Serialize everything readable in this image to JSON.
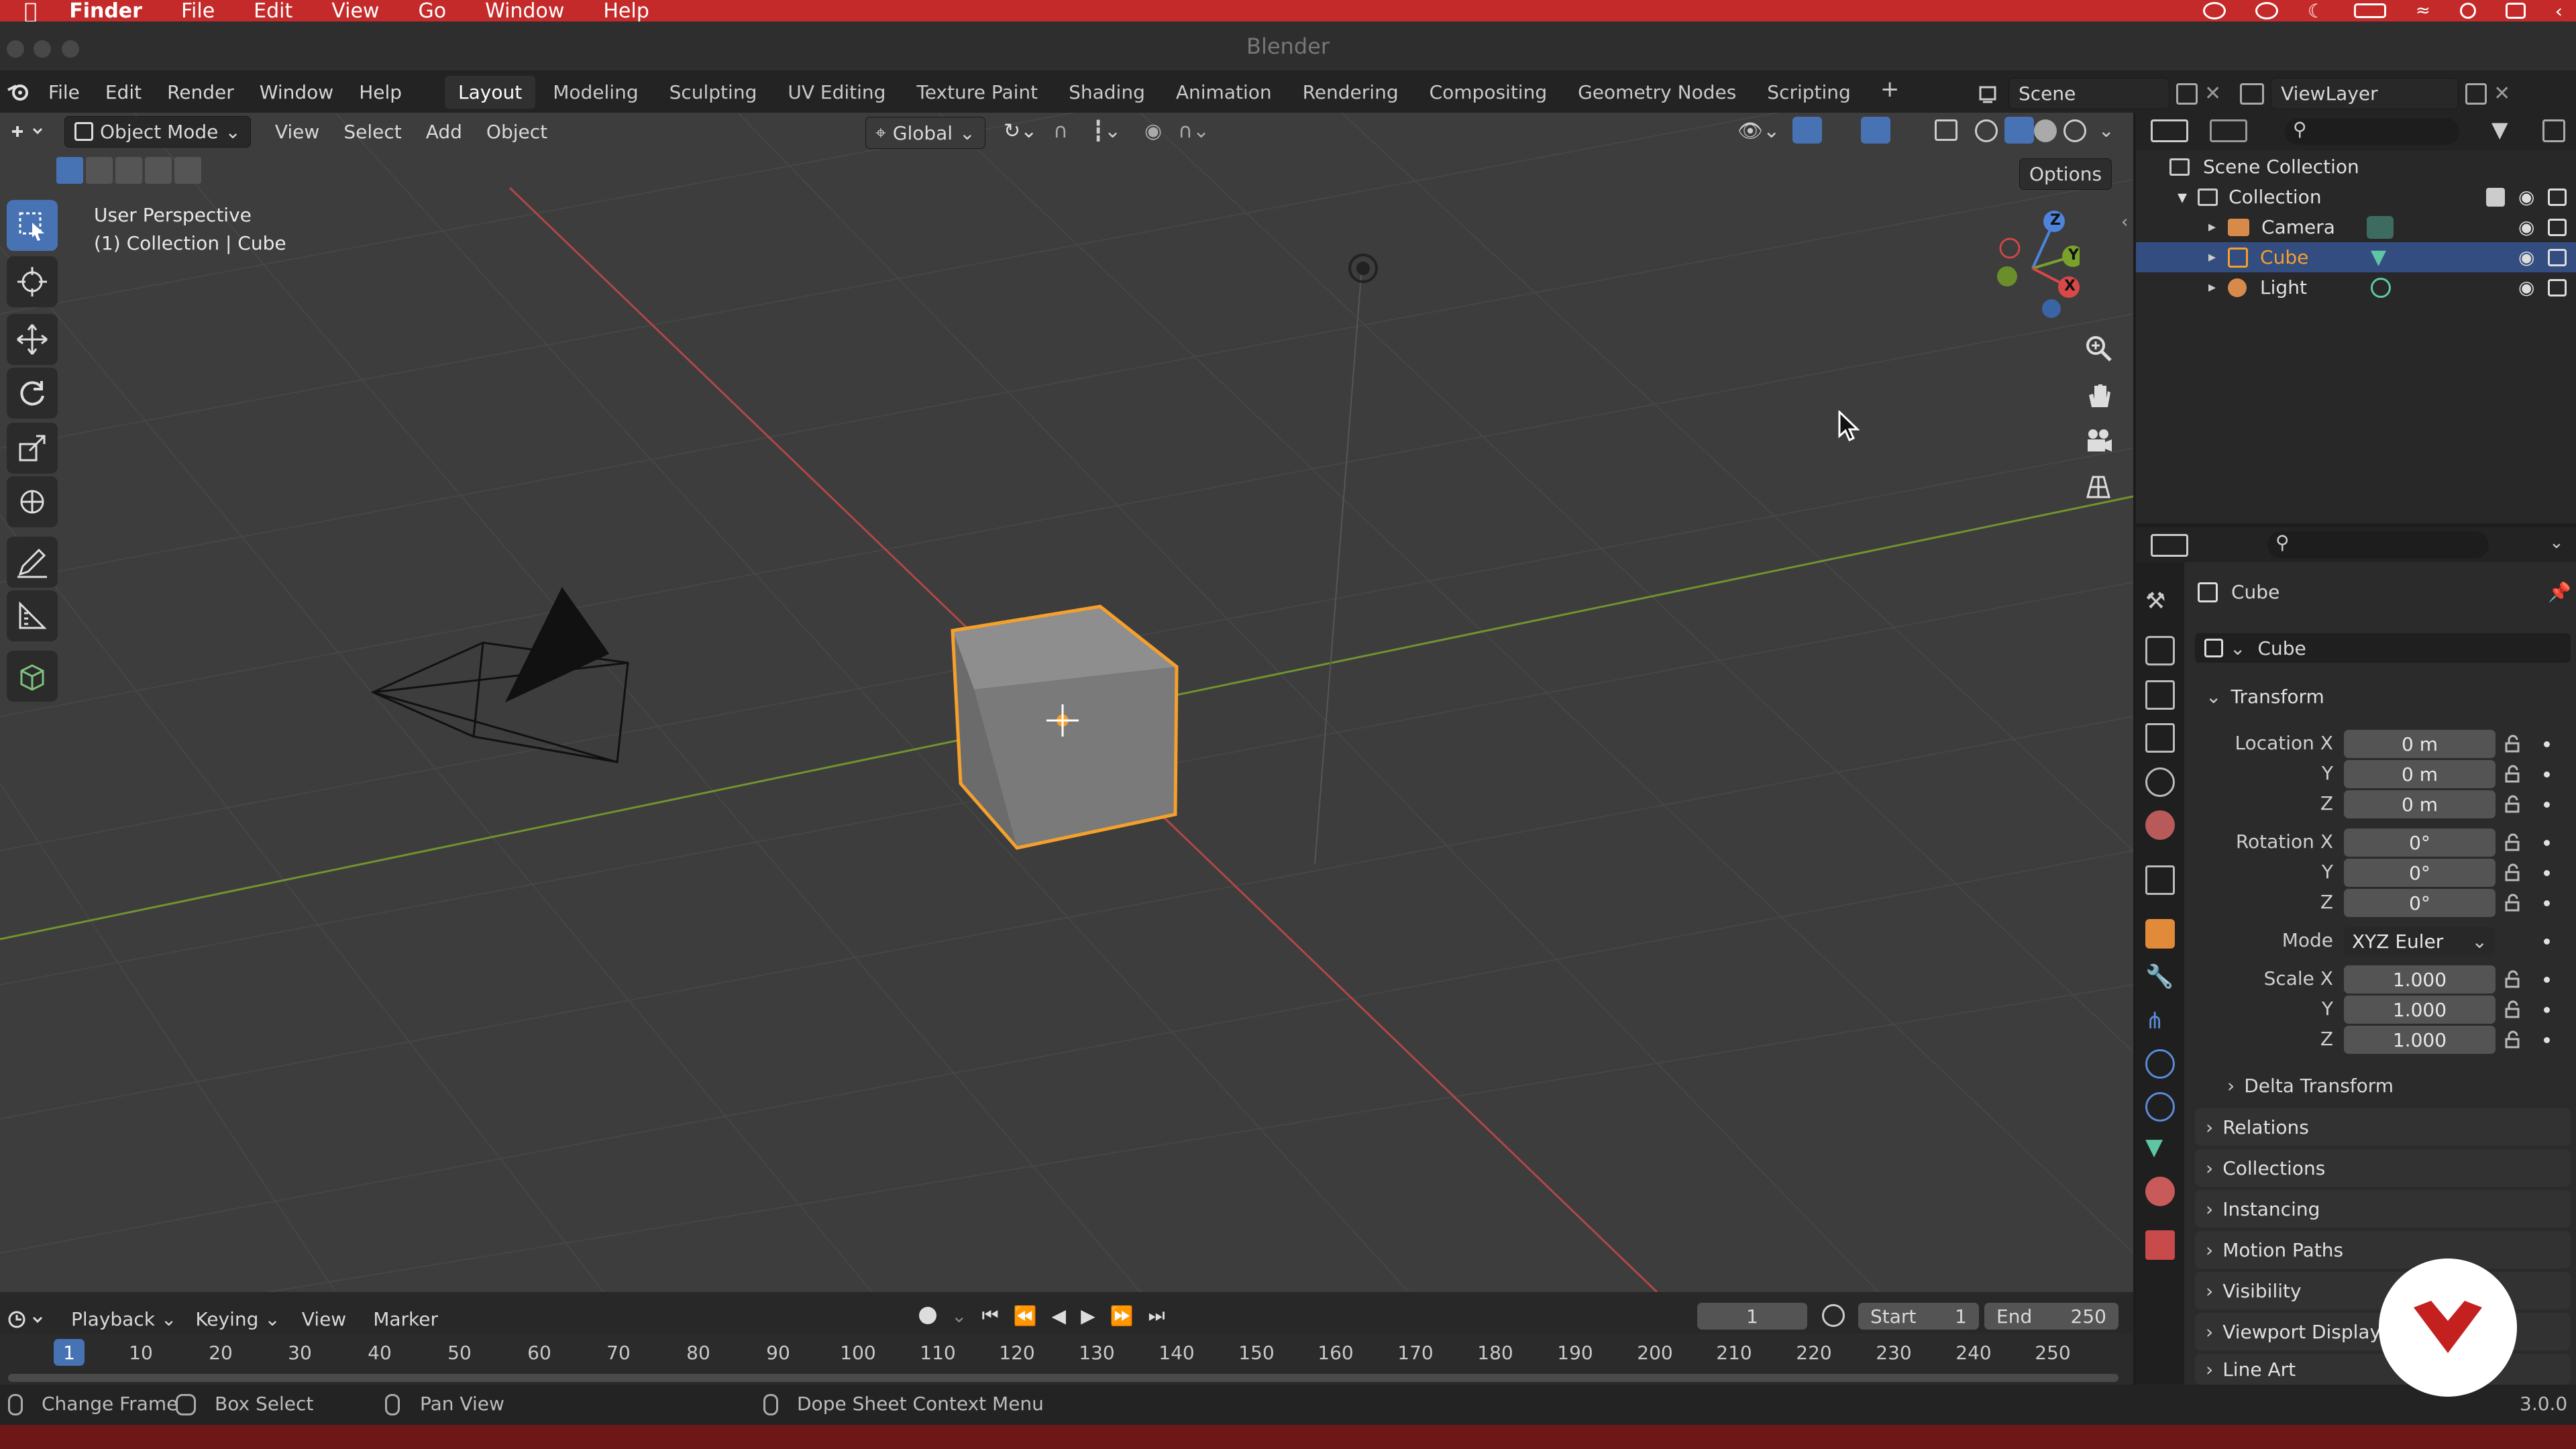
{
  "os_menu": {
    "app": "Finder",
    "items": [
      "File",
      "Edit",
      "View",
      "Go",
      "Window",
      "Help"
    ]
  },
  "window_title": "Blender",
  "top_menu": [
    "File",
    "Edit",
    "Render",
    "Window",
    "Help"
  ],
  "workspaces": [
    {
      "label": "Layout",
      "active": true
    },
    {
      "label": "Modeling"
    },
    {
      "label": "Sculpting"
    },
    {
      "label": "UV Editing"
    },
    {
      "label": "Texture Paint"
    },
    {
      "label": "Shading"
    },
    {
      "label": "Animation"
    },
    {
      "label": "Rendering"
    },
    {
      "label": "Compositing"
    },
    {
      "label": "Geometry Nodes"
    },
    {
      "label": "Scripting"
    }
  ],
  "add_workspace": "+",
  "scene": "Scene",
  "view_layer": "ViewLayer",
  "viewport": {
    "mode": "Object Mode",
    "menus": [
      "View",
      "Select",
      "Add",
      "Object"
    ],
    "transform_orientation": "Global",
    "options": "Options",
    "overlay_line1": "User Perspective",
    "overlay_line2": "(1) Collection | Cube",
    "gizmo": {
      "z": "Z",
      "y": "Y",
      "x": "X"
    }
  },
  "outliner": {
    "root": "Scene Collection",
    "collection": "Collection",
    "items": [
      {
        "label": "Camera"
      },
      {
        "label": "Cube",
        "selected": true
      },
      {
        "label": "Light"
      }
    ]
  },
  "properties": {
    "object_name": "Cube",
    "data_name": "Cube",
    "transform_title": "Transform",
    "location": {
      "label": "Location X",
      "x": "0 m",
      "y": "0 m",
      "z": "0 m"
    },
    "rotation": {
      "label": "Rotation X",
      "x": "0°",
      "y": "0°",
      "z": "0°"
    },
    "mode_label": "Mode",
    "mode_value": "XYZ Euler",
    "scale": {
      "label": "Scale X",
      "x": "1.000",
      "y": "1.000",
      "z": "1.000"
    },
    "axis_y": "Y",
    "axis_z": "Z",
    "delta": "Delta Transform",
    "panels": [
      "Relations",
      "Collections",
      "Instancing",
      "Motion Paths",
      "Visibility",
      "Viewport Display",
      "Line Art"
    ]
  },
  "timeline": {
    "menus": [
      "Playback",
      "Keying",
      "View",
      "Marker"
    ],
    "current_frame": "1",
    "start_label": "Start",
    "start": "1",
    "end_label": "End",
    "end": "250",
    "ticks": [
      "1",
      "10",
      "20",
      "30",
      "40",
      "50",
      "60",
      "70",
      "80",
      "90",
      "100",
      "110",
      "120",
      "130",
      "140",
      "150",
      "160",
      "170",
      "180",
      "190",
      "200",
      "210",
      "220",
      "230",
      "240",
      "250"
    ]
  },
  "status": {
    "change_frame": "Change Frame",
    "box_select": "Box Select",
    "pan_view": "Pan View",
    "context_menu": "Dope Sheet Context Menu",
    "version": "3.0.0"
  },
  "colors": {
    "accent_orange": "#f5a02c",
    "selection_blue": "#3b5ba7",
    "mac_red": "#c52a2a",
    "x_axis": "#c54545",
    "y_axis": "#7aa12a"
  }
}
